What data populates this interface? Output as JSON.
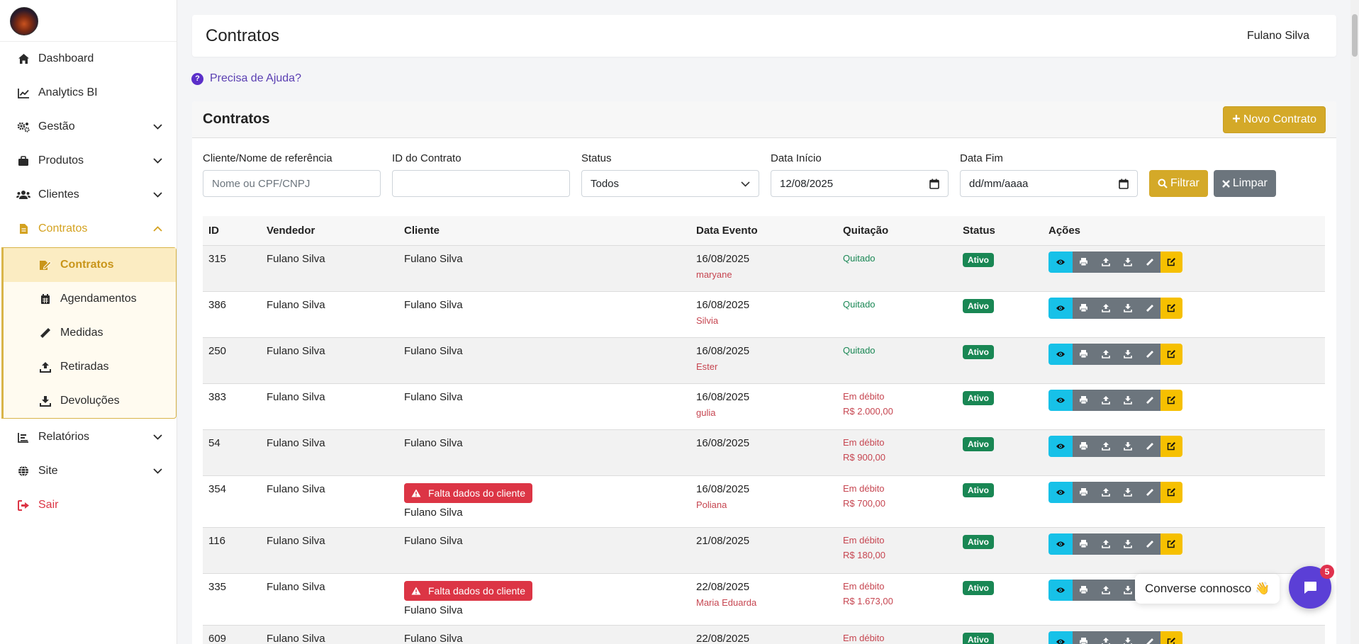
{
  "sidebar": {
    "items": [
      {
        "label": "Dashboard",
        "icon": "home-icon"
      },
      {
        "label": "Analytics BI",
        "icon": "chart-line-icon"
      },
      {
        "label": "Gestão",
        "icon": "gears-icon"
      },
      {
        "label": "Produtos",
        "icon": "briefcase-icon"
      },
      {
        "label": "Clientes",
        "icon": "users-icon"
      },
      {
        "label": "Contratos",
        "icon": "file-icon"
      },
      {
        "label": "Relatórios",
        "icon": "chart-bar-icon"
      },
      {
        "label": "Site",
        "icon": "globe-icon"
      },
      {
        "label": "Sair",
        "icon": "sign-out-icon"
      }
    ],
    "subitems": [
      {
        "label": "Contratos",
        "icon": "file-edit-icon"
      },
      {
        "label": "Agendamentos",
        "icon": "calendar-icon"
      },
      {
        "label": "Medidas",
        "icon": "ruler-icon"
      },
      {
        "label": "Retiradas",
        "icon": "upload-icon"
      },
      {
        "label": "Devoluções",
        "icon": "download-icon"
      }
    ]
  },
  "header": {
    "title": "Contratos",
    "user": "Fulano Silva"
  },
  "help": {
    "label": "Precisa de Ajuda?"
  },
  "card": {
    "title": "Contratos",
    "new_button": "Novo Contrato"
  },
  "filters": {
    "client_label": "Cliente/Nome de referência",
    "client_placeholder": "Nome ou CPF/CNPJ",
    "id_label": "ID do Contrato",
    "status_label": "Status",
    "status_value": "Todos",
    "start_label": "Data Início",
    "start_value": "12/08/2025",
    "end_label": "Data Fim",
    "end_placeholder": "dd/mm/aaaa",
    "filter_button": "Filtrar",
    "clear_button": "Limpar"
  },
  "table": {
    "headers": [
      "ID",
      "Vendedor",
      "Cliente",
      "Data Evento",
      "Quitação",
      "Status",
      "Ações"
    ],
    "warning_label": "Falta dados do cliente",
    "rows": [
      {
        "id": "315",
        "seller": "Fulano Silva",
        "client": "Fulano Silva",
        "date": "16/08/2025",
        "ref": "maryane",
        "payment": "Quitado",
        "amount": "",
        "status": "Ativo"
      },
      {
        "id": "386",
        "seller": "Fulano Silva",
        "client": "Fulano Silva",
        "date": "16/08/2025",
        "ref": "Silvia",
        "payment": "Quitado",
        "amount": "",
        "status": "Ativo"
      },
      {
        "id": "250",
        "seller": "Fulano Silva",
        "client": "Fulano Silva",
        "date": "16/08/2025",
        "ref": "Ester",
        "payment": "Quitado",
        "amount": "",
        "status": "Ativo"
      },
      {
        "id": "383",
        "seller": "Fulano Silva",
        "client": "Fulano Silva",
        "date": "16/08/2025",
        "ref": "gulia",
        "payment": "Em débito",
        "amount": "R$ 2.000,00",
        "status": "Ativo"
      },
      {
        "id": "54",
        "seller": "Fulano Silva",
        "client": "Fulano Silva",
        "date": "16/08/2025",
        "ref": "",
        "payment": "Em débito",
        "amount": "R$ 900,00",
        "status": "Ativo"
      },
      {
        "id": "354",
        "seller": "Fulano Silva",
        "client": "Fulano Silva",
        "date": "16/08/2025",
        "ref": "Poliana",
        "payment": "Em débito",
        "amount": "R$ 700,00",
        "status": "Ativo",
        "warning": true
      },
      {
        "id": "116",
        "seller": "Fulano Silva",
        "client": "Fulano Silva",
        "date": "21/08/2025",
        "ref": "",
        "payment": "Em débito",
        "amount": "R$ 180,00",
        "status": "Ativo"
      },
      {
        "id": "335",
        "seller": "Fulano Silva",
        "client": "Fulano Silva",
        "date": "22/08/2025",
        "ref": "Maria Eduarda",
        "payment": "Em débito",
        "amount": "R$ 1.673,00",
        "status": "Ativo",
        "warning": true
      },
      {
        "id": "609",
        "seller": "Fulano Silva",
        "client": "Fulano Silva",
        "date": "22/08/2025",
        "ref": "",
        "payment": "Em débito",
        "amount": "",
        "status": "Ativo"
      }
    ]
  },
  "chat": {
    "label": "Converse connosco 👋",
    "count": "5"
  },
  "colors": {
    "accent": "#d4a928",
    "danger": "#dc3545",
    "success": "#198754",
    "info": "#17c1e8",
    "warning": "#f6c000",
    "secondary": "#6c757d",
    "chat": "#5b3fd6"
  }
}
